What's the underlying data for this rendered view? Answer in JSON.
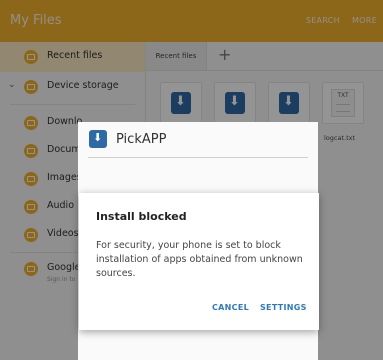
{
  "app": {
    "title": "My Files",
    "actions": {
      "search": "SEARCH",
      "more": "MORE"
    }
  },
  "sidebar": {
    "items": [
      {
        "label": "Recent files",
        "selected": true
      },
      {
        "label": "Device storage",
        "expandable": true
      },
      {
        "label": "Downlo"
      },
      {
        "label": "Docume"
      },
      {
        "label": "Images"
      },
      {
        "label": "Audio"
      },
      {
        "label": "Videos"
      },
      {
        "label": "Google",
        "sublabel": "Sign in to"
      }
    ]
  },
  "main": {
    "tab": "Recent files",
    "add_tab": "+",
    "files": [
      {
        "type": "apk"
      },
      {
        "type": "apk"
      },
      {
        "type": "apk"
      },
      {
        "type": "txt",
        "icon_text": "TXT",
        "label": "logcat.txt"
      }
    ]
  },
  "background_app": {
    "name": "PickAPP"
  },
  "dialog": {
    "title": "Install blocked",
    "message": "For security, your phone is set to block installation of apps obtained from unknown sources.",
    "cancel": "CANCEL",
    "settings": "SETTINGS"
  },
  "colors": {
    "accent": "#f2b12c",
    "selected_bg": "#fbe8c3",
    "button_text": "#2d7ab8",
    "apk_blue": "#2d6aa6"
  }
}
